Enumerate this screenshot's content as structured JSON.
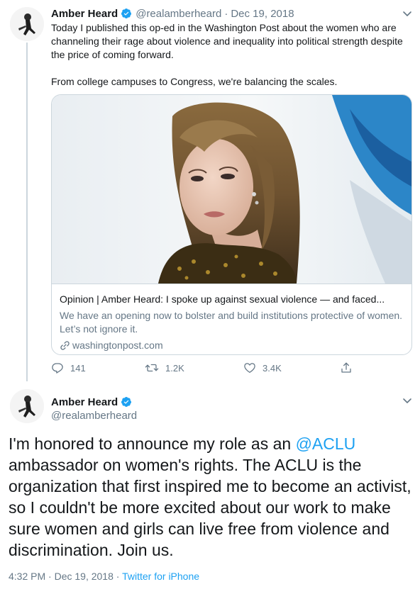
{
  "tweet1": {
    "author_name": "Amber Heard",
    "author_handle": "@realamberheard",
    "separator": "·",
    "date": "Dec 19, 2018",
    "text_paragraph_1": "Today I published this op-ed in the Washington Post about the women who are channeling their rage about violence and inequality into political strength despite the price of coming forward.",
    "text_paragraph_2": "From college campuses to Congress, we're balancing the scales.",
    "card": {
      "title": "Opinion | Amber Heard: I spoke up against sexual violence — and faced...",
      "description": "We have an opening now to bolster and build institutions protective of women. Let’s not ignore it.",
      "domain": "washingtonpost.com"
    },
    "actions": {
      "replies": "141",
      "retweets": "1.2K",
      "likes": "3.4K"
    }
  },
  "tweet2": {
    "author_name": "Amber Heard",
    "author_handle": "@realamberheard",
    "text_before_mention": "I'm honored to announce my role as an ",
    "mention": "@ACLU",
    "text_after_mention": " ambassador on women's rights. The ACLU is the organization that first inspired me to become an activist, so I couldn't be more excited about our work to make sure women and girls can live free from violence and discrimination. Join us.",
    "time": "4:32 PM",
    "separator": " · ",
    "date": "Dec 19, 2018",
    "separator2": " · ",
    "source": "Twitter for iPhone"
  },
  "colors": {
    "link_blue": "#1da1f2",
    "secondary_text": "#657786",
    "border": "#ccd6dd",
    "verified_badge": "#1da1f2"
  },
  "icons": [
    "verified-badge-icon",
    "chevron-down-icon",
    "link-icon",
    "reply-icon",
    "retweet-icon",
    "like-icon",
    "share-icon"
  ]
}
